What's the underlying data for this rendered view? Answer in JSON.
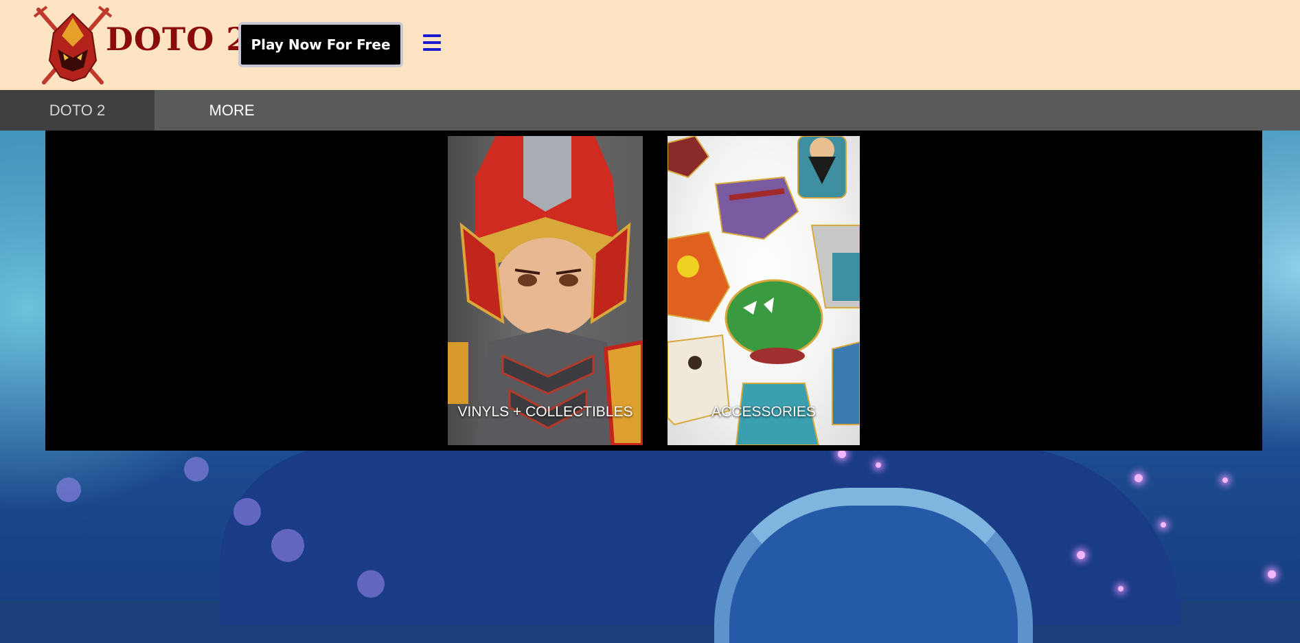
{
  "header": {
    "brand_name": "DOTO 2",
    "play_button_label": "Play Now For Free",
    "logo_icon": "helmet-crossed-swords-logo",
    "menu_icon": "hamburger-icon",
    "background_color": "#ffe4c4",
    "brand_color": "#8b0b0b"
  },
  "nav": {
    "items": [
      {
        "label": "DOTO 2",
        "active": true
      },
      {
        "label": "MORE",
        "active": false
      }
    ],
    "background_color": "#5a5a5a"
  },
  "menu_panel": {
    "cards": [
      {
        "label": "VINYLS + COLLECTIBLES",
        "image": "armored-knight-figurine-image"
      },
      {
        "label": "ACCESSORIES",
        "image": "enamel-pins-collection-image"
      }
    ]
  }
}
